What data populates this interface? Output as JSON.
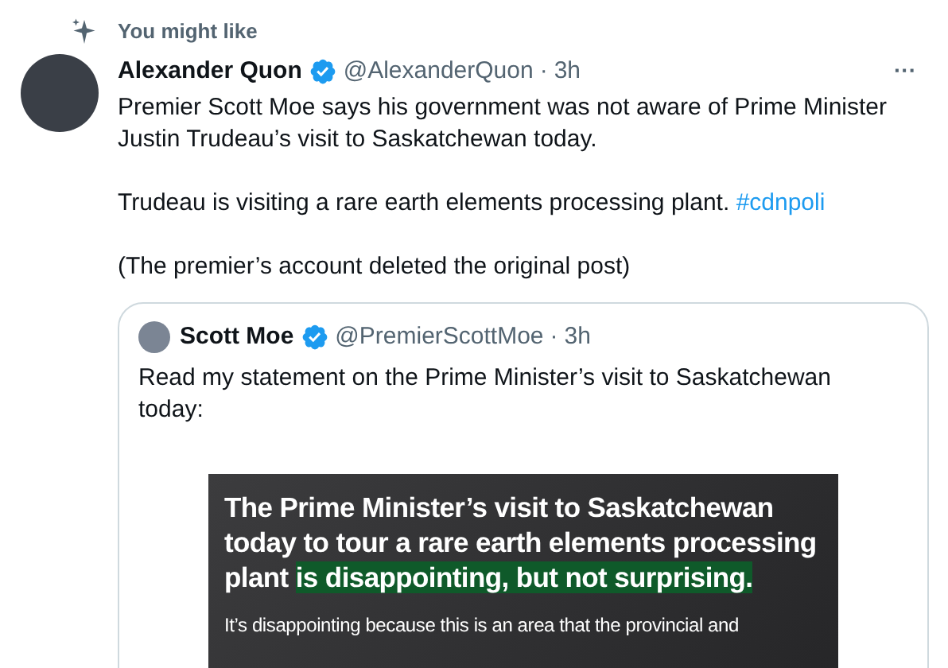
{
  "context": {
    "label": "You might like"
  },
  "tweet": {
    "name": "Alexander Quon",
    "verified": true,
    "handle": "@AlexanderQuon",
    "separator": "·",
    "time": "3h",
    "more": "···",
    "paragraphs": [
      {
        "text": "Premier Scott Moe says his government was not aware of Prime Minister Justin Trudeau’s visit to Saskatchewan today."
      },
      {
        "text": "Trudeau is visiting a rare earth elements processing plant.",
        "hashtag": "#cdnpoli"
      },
      {
        "text": "(The premier’s account deleted the original post)"
      }
    ]
  },
  "quoted_tweet": {
    "name": "Scott Moe",
    "verified": true,
    "handle": "@PremierScottMoe",
    "separator": "·",
    "time": "3h",
    "text": "Read my statement on the Prime Minister’s visit to Saskatchewan today:",
    "graphic": {
      "headline": "The Prime Minister’s visit to Saskatchewan today to tour a rare earth elements processing plant",
      "headline_highlight": "is disappointing, but not surprising.",
      "body": "It’s disappointing because this is an area that the provincial and"
    }
  }
}
